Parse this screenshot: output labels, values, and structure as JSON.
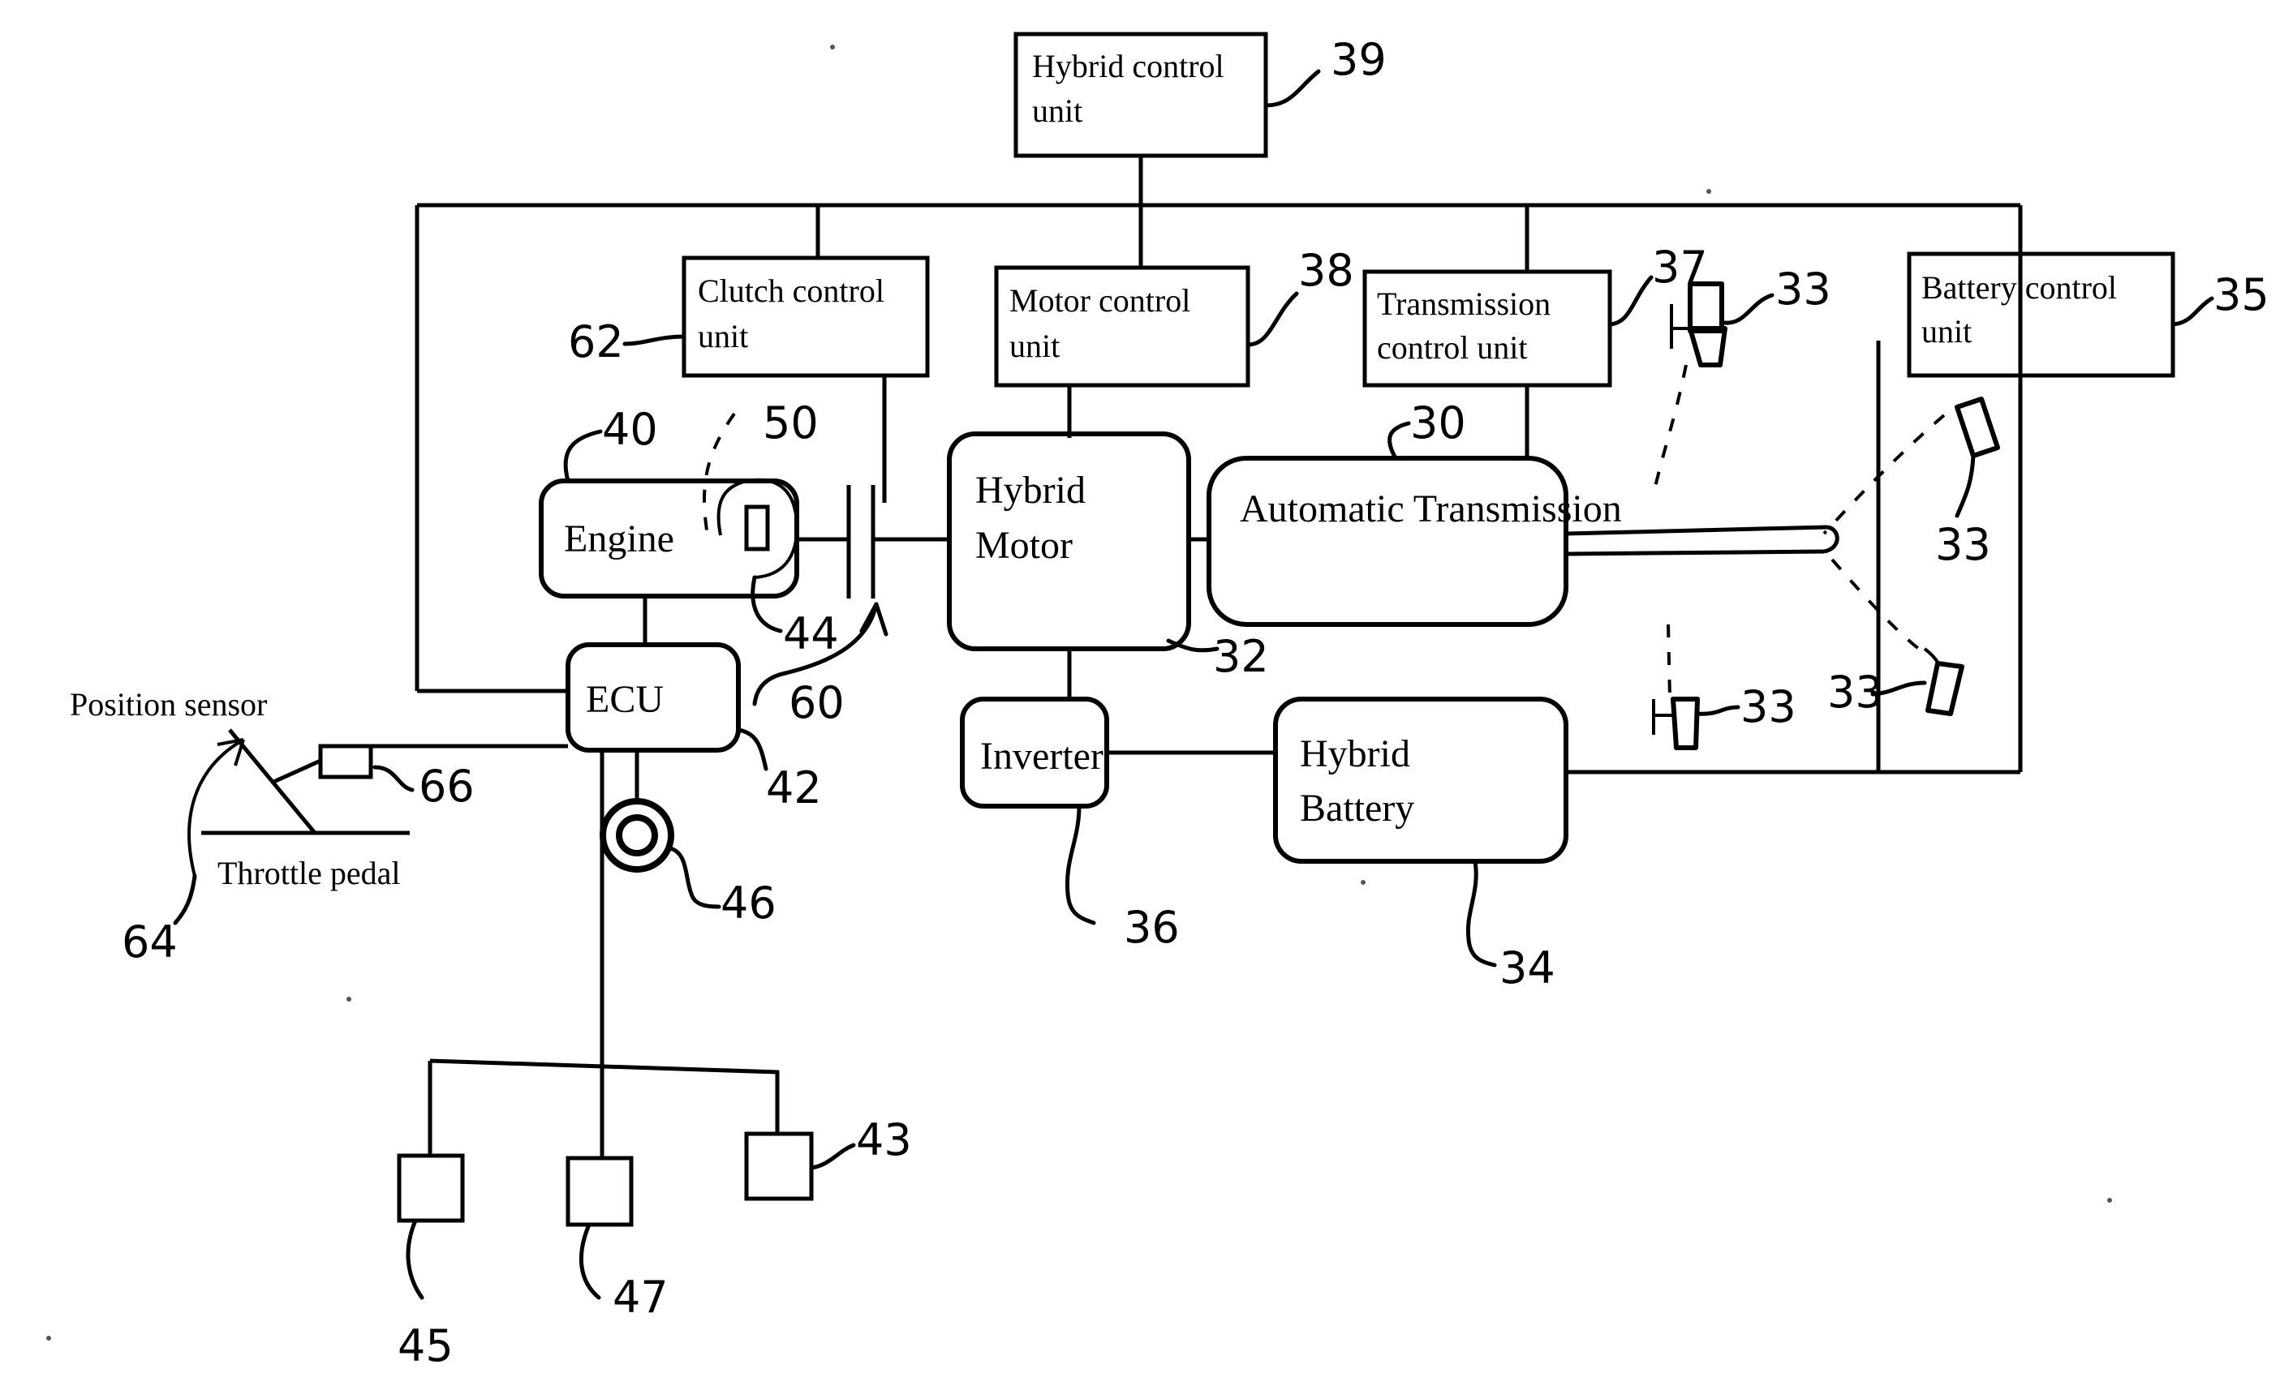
{
  "diagram": {
    "title": "Hybrid vehicle powertrain control block diagram",
    "boxes": {
      "hybrid_control_unit": {
        "line1": "Hybrid control",
        "line2": "unit",
        "ref": "39"
      },
      "clutch_control_unit": {
        "line1": "Clutch control",
        "line2": "unit",
        "ref": "62"
      },
      "motor_control_unit": {
        "line1": "Motor control",
        "line2": "unit",
        "ref": "38"
      },
      "transmission_control_unit": {
        "line1": "Transmission",
        "line2": "control unit",
        "ref": "37"
      },
      "battery_control_unit": {
        "line1": "Battery control",
        "line2": "unit",
        "ref": "35"
      },
      "engine": {
        "line1": "Engine",
        "ref": "40"
      },
      "hybrid_motor": {
        "line1": "Hybrid",
        "line2": "Motor",
        "ref": "32"
      },
      "automatic_transmission": {
        "line1": "Automatic Transmission",
        "ref": "30"
      },
      "ecu": {
        "line1": "ECU",
        "ref": "42"
      },
      "inverter": {
        "line1": "Inverter",
        "ref": "36"
      },
      "hybrid_battery": {
        "line1": "Hybrid",
        "line2": "Battery",
        "ref": "34"
      }
    },
    "labels": {
      "position_sensor": "Position sensor",
      "throttle_pedal": "Throttle pedal"
    },
    "refs": {
      "clutch_assembly": "50",
      "engine_internal": "44",
      "clutch_actuator": "60",
      "pedal_sensor_box": "66",
      "pedal_assembly": "64",
      "ecu_circle": "46",
      "sensor_box_right": "43",
      "sensor_box_left": "45",
      "sensor_box_mid": "47",
      "wheel_top": "33",
      "wheel_right": "33",
      "wheel_bottom_left": "33",
      "wheel_bottom_right": "33"
    },
    "colors": {
      "ink": "#000000",
      "paper": "#ffffff"
    }
  }
}
